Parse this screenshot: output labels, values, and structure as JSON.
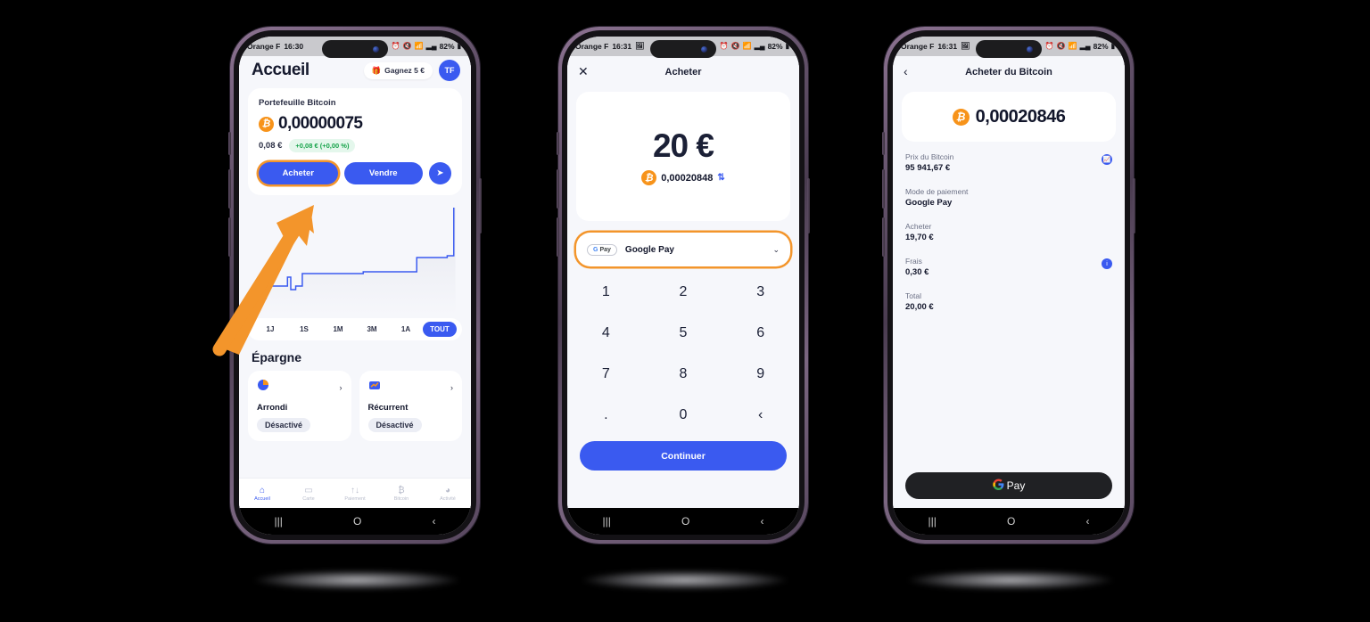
{
  "colors": {
    "brand_blue": "#3a5af0",
    "accent_orange": "#f3952b",
    "bitcoin_orange": "#f7931a",
    "green": "#16a34a",
    "screen_bg": "#f6f7fb"
  },
  "status_bar": {
    "carrier": "Orange F",
    "time_phone1": "16:30",
    "time_phone2": "16:31",
    "time_phone3": "16:31",
    "battery": "82%",
    "icons": [
      "alarm-icon",
      "mute-icon",
      "wifi-icon",
      "signal-icon",
      "battery-icon"
    ],
    "screenshot_icon": "image-icon"
  },
  "android_nav": {
    "recents": "|||",
    "home": "O",
    "back": "‹"
  },
  "phone1": {
    "title": "Accueil",
    "reward_button": "Gagnez 5 €",
    "reward_icon": "gift-icon",
    "avatar_initials": "TF",
    "wallet": {
      "label": "Portefeuille Bitcoin",
      "btc_icon": "bitcoin-icon",
      "btc_amount": "0,00000075",
      "fiat_amount": "0,08 €",
      "delta": "+0,08 € (+0,00 %)"
    },
    "actions": {
      "buy": "Acheter",
      "sell": "Vendre",
      "send_icon": "send-icon"
    },
    "ranges": [
      "1J",
      "1S",
      "1M",
      "3M",
      "1A",
      "TOUT"
    ],
    "active_range": "TOUT",
    "savings": {
      "title": "Épargne",
      "cards": [
        {
          "icon": "pie-chart-icon",
          "name": "Arrondi",
          "status": "Désactivé",
          "chevron": "›"
        },
        {
          "icon": "trend-chart-icon",
          "name": "Récurrent",
          "status": "Désactivé",
          "chevron": "›"
        }
      ]
    },
    "tabs": [
      {
        "icon": "home-icon",
        "label": "Accueil",
        "active": true
      },
      {
        "icon": "card-icon",
        "label": "Carte",
        "active": false
      },
      {
        "icon": "transfer-icon",
        "label": "Paiement",
        "active": false
      },
      {
        "icon": "bitcoin-icon",
        "label": "Bitcoin",
        "active": false
      },
      {
        "icon": "clock-icon",
        "label": "Activité",
        "active": false
      }
    ],
    "annotation": {
      "type": "arrow",
      "points_to": "Acheter",
      "color": "#f3952b"
    }
  },
  "phone2": {
    "close_icon": "close-icon",
    "title": "Acheter",
    "amount": "20 €",
    "btc_icon": "bitcoin-icon",
    "btc_equivalent": "0,00020848",
    "swap_icon": "swap-vertical-icon",
    "payment": {
      "logo": "gpay-icon",
      "logo_text": "Pay",
      "name": "Google Pay",
      "chevron_icon": "chevron-down-icon"
    },
    "keypad": [
      "1",
      "2",
      "3",
      "4",
      "5",
      "6",
      "7",
      "8",
      "9",
      ".",
      "0",
      "‹"
    ],
    "cta": "Continuer"
  },
  "phone3": {
    "back_icon": "chevron-left-icon",
    "title": "Acheter du Bitcoin",
    "btc_icon": "bitcoin-icon",
    "btc_amount": "0,00020846",
    "rows": [
      {
        "label": "Prix du Bitcoin",
        "value": "95 941,67 €",
        "icon": "chart-icon"
      },
      {
        "label": "Mode de paiement",
        "value": "Google Pay",
        "icon": ""
      },
      {
        "label": "Acheter",
        "value": "19,70 €",
        "icon": ""
      },
      {
        "label": "Frais",
        "value": "0,30 €",
        "icon": "info-icon"
      },
      {
        "label": "Total",
        "value": "20,00 €",
        "icon": ""
      }
    ],
    "pay_button": {
      "logo": "google-g-icon",
      "label": "Pay"
    }
  }
}
